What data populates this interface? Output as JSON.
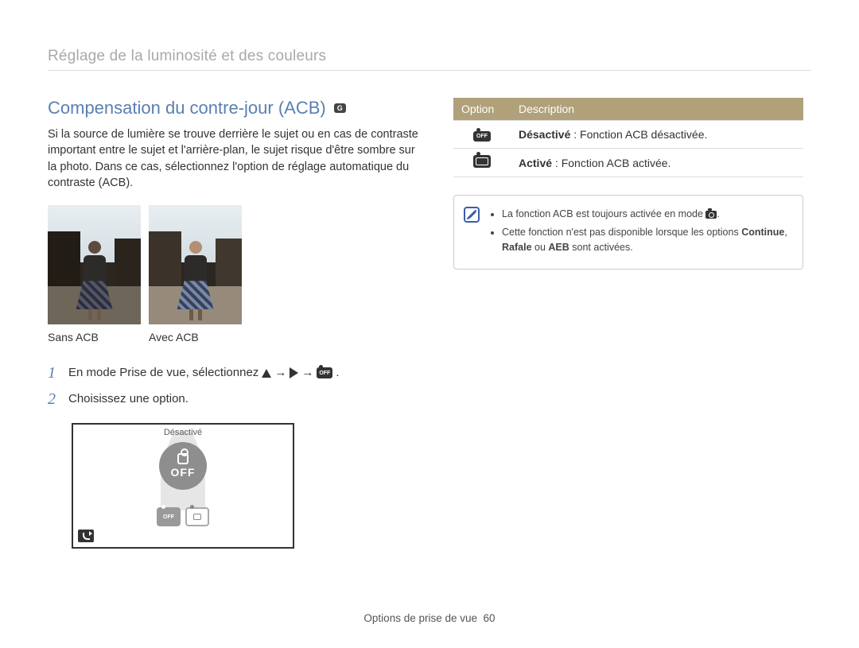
{
  "header": {
    "title": "Réglage de la luminosité et des couleurs"
  },
  "section": {
    "title": "Compensation du contre-jour (ACB)",
    "mode_icon": "G",
    "body": "Si la source de lumière se trouve derrière le sujet ou en cas de contraste important entre le sujet et l'arrière-plan, le sujet risque d'être sombre sur la photo. Dans ce cas, sélectionnez l'option de réglage automatique du contraste (ACB)."
  },
  "photos": {
    "caption_left": "Sans ACB",
    "caption_right": "Avec ACB"
  },
  "steps": [
    {
      "num": "1",
      "text_before": "En mode Prise de vue, sélectionnez",
      "arrow": "→",
      "dot": "."
    },
    {
      "num": "2",
      "text": "Choisissez une option."
    }
  ],
  "camera_screen": {
    "label": "Désactivé",
    "big_off": "OFF",
    "opt_off": "OFF"
  },
  "option_table": {
    "header_option": "Option",
    "header_desc": "Description",
    "rows": [
      {
        "icon": "OFF",
        "bold": "Désactivé",
        "rest": " : Fonction ACB désactivée."
      },
      {
        "icon": "ON",
        "bold": "Activé",
        "rest": " : Fonction ACB activée."
      }
    ]
  },
  "note": {
    "line1_pre": "La fonction ACB est toujours activée en mode ",
    "line1_post": ".",
    "line2_pre": "Cette fonction n'est pas disponible lorsque les options ",
    "cont": "Continue",
    "comma": ", ",
    "rafale": "Rafale",
    "or": " ou ",
    "aeb": "AEB",
    "line2_post": " sont activées."
  },
  "footer": {
    "section": "Options de prise de vue",
    "page": "60"
  }
}
